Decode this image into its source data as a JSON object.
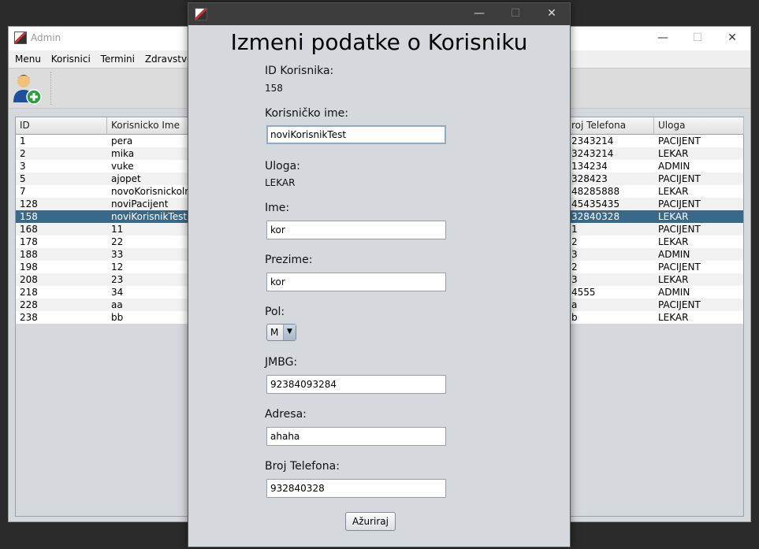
{
  "main_window": {
    "title": "Admin",
    "controls": {
      "minimize": "—",
      "maximize": "☐",
      "close": "✕"
    },
    "menu": [
      "Menu",
      "Korisnici",
      "Termini",
      "Zdravstveni K"
    ],
    "toolbar": {
      "add_user_icon": "add-user-icon"
    },
    "table": {
      "headers": {
        "id": "ID",
        "username": "Korisnicko Ime",
        "phone": "roj Telefona",
        "role": "Uloga"
      },
      "rows": [
        {
          "id": "1",
          "username": "pera",
          "phone": "2343214",
          "role": "PACIJENT"
        },
        {
          "id": "2",
          "username": "mika",
          "phone": "3243214",
          "role": "LEKAR"
        },
        {
          "id": "3",
          "username": "vuke",
          "phone": "134234",
          "role": "ADMIN"
        },
        {
          "id": "5",
          "username": "ajopet",
          "phone": "328423",
          "role": "PACIJENT"
        },
        {
          "id": "7",
          "username": "novoKorisnickolm",
          "phone": "48285888",
          "role": "LEKAR"
        },
        {
          "id": "128",
          "username": "noviPacijent",
          "phone": "45435435",
          "role": "PACIJENT"
        },
        {
          "id": "158",
          "username": "noviKorisnikTest",
          "phone": "32840328",
          "role": "LEKAR",
          "selected": true
        },
        {
          "id": "168",
          "username": "11",
          "phone": "1",
          "role": "PACIJENT"
        },
        {
          "id": "178",
          "username": "22",
          "phone": "2",
          "role": "LEKAR"
        },
        {
          "id": "188",
          "username": "33",
          "phone": "3",
          "role": "ADMIN"
        },
        {
          "id": "198",
          "username": "12",
          "phone": "2",
          "role": "PACIJENT"
        },
        {
          "id": "208",
          "username": "23",
          "phone": "3",
          "role": "LEKAR"
        },
        {
          "id": "218",
          "username": "34",
          "phone": "4555",
          "role": "ADMIN"
        },
        {
          "id": "228",
          "username": "aa",
          "phone": "a",
          "role": "PACIJENT"
        },
        {
          "id": "238",
          "username": "bb",
          "phone": "b",
          "role": "LEKAR"
        }
      ]
    }
  },
  "dialog": {
    "controls": {
      "minimize": "—",
      "maximize": "☐",
      "close": "✕"
    },
    "title": "Izmeni podatke o Korisniku",
    "id_label": "ID Korisnika:",
    "id_value": "158",
    "username_label": "Korisničko ime:",
    "username_value": "noviKorisnikTest",
    "role_label": "Uloga:",
    "role_value": "LEKAR",
    "first_name_label": "Ime:",
    "first_name_value": "kor",
    "last_name_label": "Prezime:",
    "last_name_value": "kor",
    "gender_label": "Pol:",
    "gender_value": "M",
    "gender_arrow": "▼",
    "jmbg_label": "JMBG:",
    "jmbg_value": "92384093284",
    "address_label": "Adresa:",
    "address_value": "ahaha",
    "phone_label": "Broj Telefona:",
    "phone_value": "932840328",
    "update_button": "Ažuriraj"
  }
}
